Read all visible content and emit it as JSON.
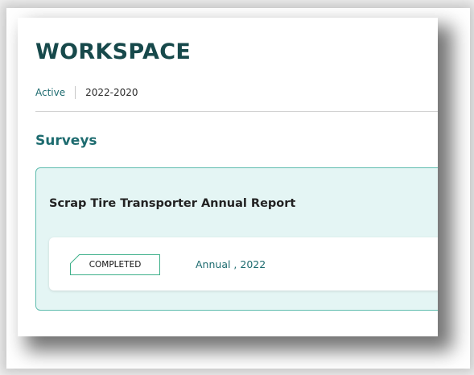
{
  "header": {
    "title": "WORKSPACE"
  },
  "tabs": [
    {
      "label": "Active",
      "active": true
    },
    {
      "label": "2022-2020",
      "active": false
    }
  ],
  "section": {
    "title": "Surveys"
  },
  "surveys": [
    {
      "title": "Scrap Tire Transporter Annual Report",
      "status": "COMPLETED",
      "period": "Annual , 2022"
    }
  ],
  "colors": {
    "title": "#17494b",
    "accent": "#1d6b6f",
    "card_bg": "#e4f5f4",
    "card_border": "#5fbcae",
    "badge_border": "#3fb08a"
  },
  "icons": {
    "badge_corner": "folded-corner-icon"
  }
}
